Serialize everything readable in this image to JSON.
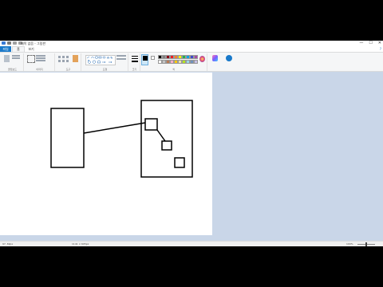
{
  "window": {
    "title": "제목 없음 - 그림판",
    "controls": {
      "minimize": "—",
      "maximize": "☐",
      "close": "✕"
    }
  },
  "tabs": {
    "file": "파일",
    "home": "홈",
    "view": "보기"
  },
  "ribbon": {
    "groups": {
      "clipboard": "클립보드",
      "image": "이미지",
      "tools": "도구",
      "shapes": "도형",
      "colors": "색"
    },
    "buttons": {
      "paste": "붙여넣기",
      "select": "선택",
      "size": "크기",
      "color1": "색 1",
      "color2": "색 2",
      "edit_colors": "색 편집",
      "paint3d": "그림판 3D로 편집",
      "product_alert": "제품 알림"
    },
    "palette": [
      "#000000",
      "#7f7f7f",
      "#880015",
      "#ed1c24",
      "#ff7f27",
      "#fff200",
      "#22b14c",
      "#00a2e8",
      "#3f48cc",
      "#a349a4",
      "#ffffff",
      "#c3c3c3",
      "#b97a57",
      "#ffaec9",
      "#ffc90e",
      "#efe4b0",
      "#b5e61d",
      "#99d9ea",
      "#7092be",
      "#c8bfe7"
    ]
  },
  "status": {
    "pos": "97, 69px",
    "selection": "",
    "size": "1141 × 605px",
    "zoom": "100%"
  },
  "colors": {
    "accent": "#1979ca",
    "workspace": "#c9d6e8",
    "canvas": "#ffffff"
  }
}
